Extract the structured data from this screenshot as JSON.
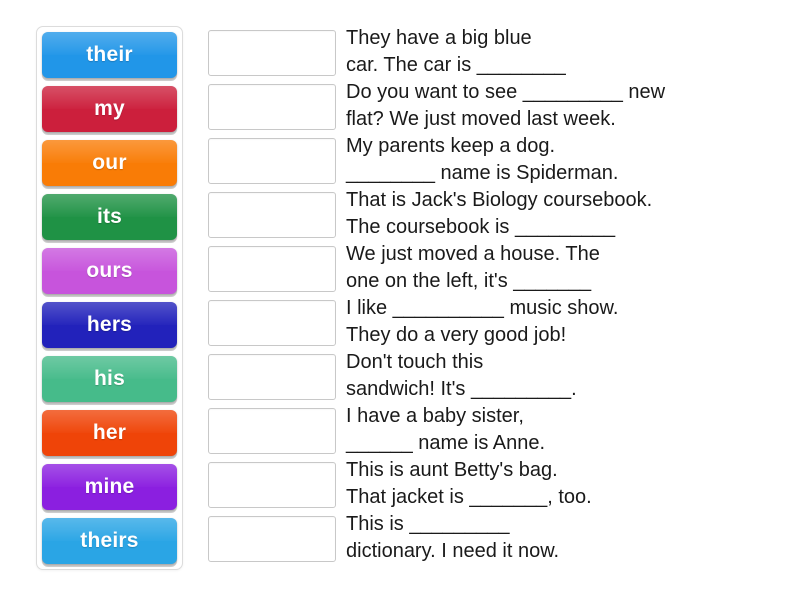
{
  "activity": {
    "type": "drag-and-drop-match",
    "background_color": "#ffffff"
  },
  "tile_bank": {
    "label": "possessive-words-bank",
    "tiles": [
      {
        "label": "their",
        "color": "#2196e8"
      },
      {
        "label": "my",
        "color": "#cc1f3c"
      },
      {
        "label": "our",
        "color": "#f97c06"
      },
      {
        "label": "its",
        "color": "#1f9245"
      },
      {
        "label": "ours",
        "color": "#c754dc"
      },
      {
        "label": "hers",
        "color": "#2222bb"
      },
      {
        "label": "his",
        "color": "#46bb8a"
      },
      {
        "label": "her",
        "color": "#ef4408"
      },
      {
        "label": "mine",
        "color": "#8b1fe0"
      },
      {
        "label": "theirs",
        "color": "#2aa5e5"
      }
    ]
  },
  "sentences": {
    "dropzone_placeholder": "",
    "items": [
      {
        "text": "They have a big blue\ncar. The car is ________"
      },
      {
        "text": "Do you want to see _________ new\nflat? We just moved last week."
      },
      {
        "text": "My parents keep a dog.\n________ name is Spiderman."
      },
      {
        "text": "That is Jack's Biology coursebook.\nThe coursebook is _________"
      },
      {
        "text": "We just moved a house. The\none on the left, it's _______"
      },
      {
        "text": "I like __________ music show.\nThey do a very good job!"
      },
      {
        "text": "Don't touch this\nsandwich! It's _________."
      },
      {
        "text": "I have a baby sister,\n______ name is Anne."
      },
      {
        "text": "This is aunt Betty's bag.\nThat jacket is _______, too."
      },
      {
        "text": "This is _________\ndictionary. I need it now."
      }
    ]
  }
}
